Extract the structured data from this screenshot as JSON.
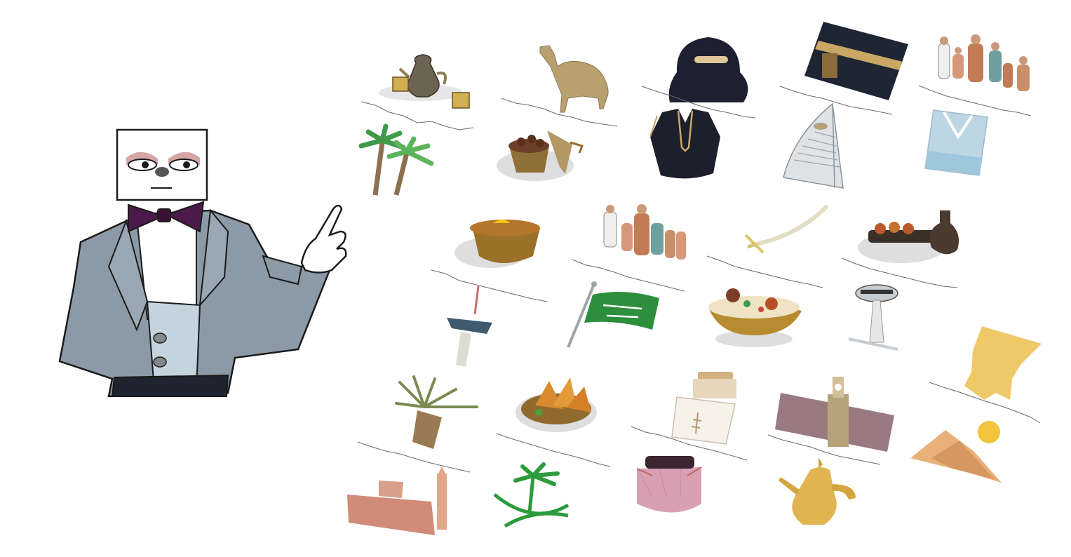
{
  "scene": {
    "background": "#ffffff",
    "character": {
      "icon": "box-head-gentleman-pointing",
      "suit_color": "#8c9aa8",
      "bowtie_color": "#4b1a4a",
      "vest_color": "#c4d4df"
    },
    "items": [
      {
        "icon": "coffee-pot-with-cups-icon"
      },
      {
        "icon": "camel-icon"
      },
      {
        "icon": "niqab-icon"
      },
      {
        "icon": "kaaba-icon"
      },
      {
        "icon": "family-group-icon"
      },
      {
        "icon": "palm-trees-icon"
      },
      {
        "icon": "dates-bowl-icon"
      },
      {
        "icon": "abaya-icon"
      },
      {
        "icon": "burj-al-arab-icon"
      },
      {
        "icon": "water-glass-icon"
      },
      {
        "icon": "nuts-bowl-with-lemon-icon"
      },
      {
        "icon": "family-group-icon"
      },
      {
        "icon": "sword-icon"
      },
      {
        "icon": "grilled-meat-platter-icon"
      },
      {
        "icon": "tv-tower-icon"
      },
      {
        "icon": "saudi-flag-icon"
      },
      {
        "icon": "kabsa-rice-dish-icon"
      },
      {
        "icon": "water-tower-icon"
      },
      {
        "icon": "crown-icon"
      },
      {
        "icon": "palm-tree-trunk-icon"
      },
      {
        "icon": "samosa-plate-icon"
      },
      {
        "icon": "perfume-bottle-icon"
      },
      {
        "icon": "clock-tower-icon"
      },
      {
        "icon": "desert-dunes-sun-icon"
      },
      {
        "icon": "mud-fort-icon"
      },
      {
        "icon": "palm-swords-emblem-icon"
      },
      {
        "icon": "shemagh-headdress-icon"
      },
      {
        "icon": "dallah-coffee-pot-icon"
      }
    ]
  }
}
